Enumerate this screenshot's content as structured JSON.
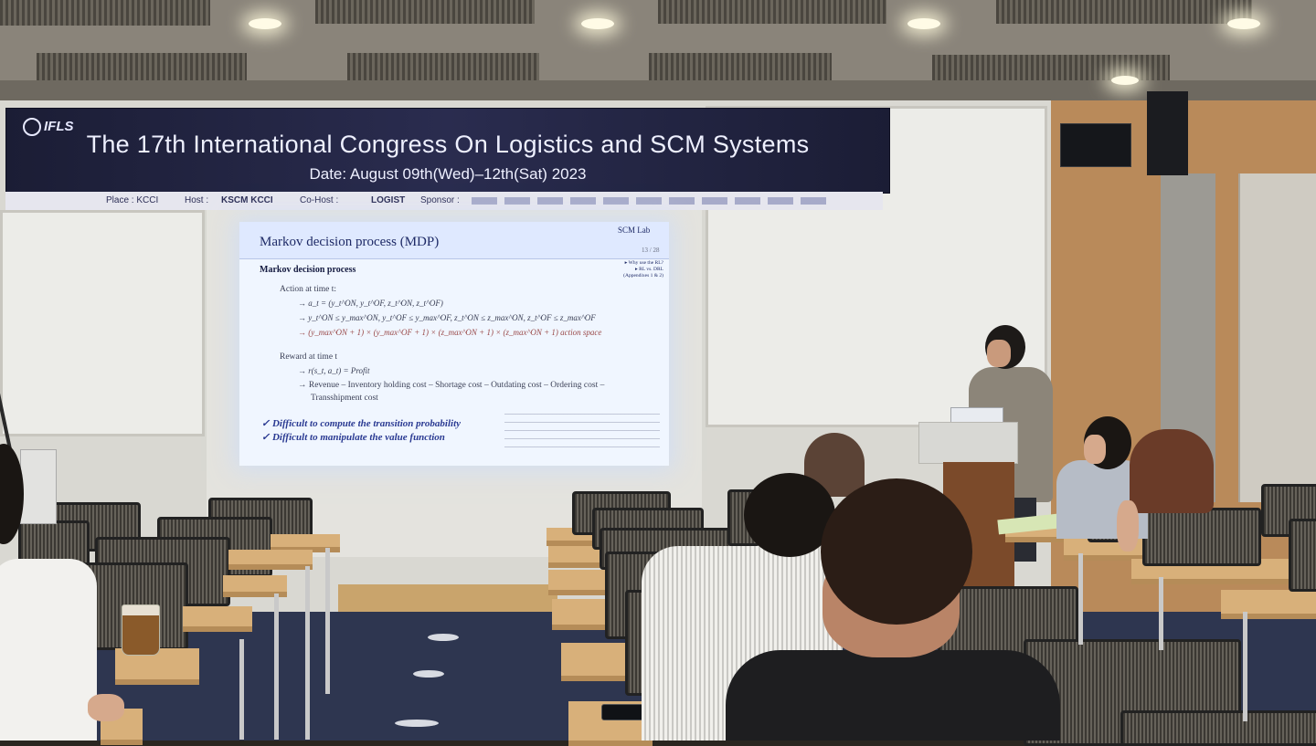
{
  "banner": {
    "logo": "IFLS",
    "title": "The 17th International Congress On Logistics and SCM Systems",
    "date": "Date: August 09th(Wed)–12th(Sat) 2023",
    "place": "Place : KCCI",
    "host": "Host :",
    "host_names": "KSCM   KCCI",
    "cohost": "Co-Host :",
    "cohost_name": "LOGIST",
    "sponsor": "Sponsor :"
  },
  "slide": {
    "title": "Markov decision process (MDP)",
    "lab": "SCM Lab",
    "page": "13 / 28",
    "subtitle": "Markov decision process",
    "side_box": [
      "▸ Why use the RL?",
      "▸ RL vs. DRL",
      "(Appendixes 1 & 2)"
    ],
    "action_header": "Action at time t:",
    "action_line1": "→ a_t = (y_t^ON, y_t^OF, z_t^ON, z_t^OF)",
    "action_line2": "→ y_t^ON ≤ y_max^ON, y_t^OF ≤ y_max^OF, z_t^ON ≤ z_max^ON, z_t^OF ≤ z_max^OF",
    "action_line3": "→ (y_max^ON + 1) × (y_max^OF + 1) × (z_max^ON + 1) × (z_max^ON + 1) action space",
    "reward_header": "Reward at time t",
    "reward_line1": "→ r(s_t, a_t) = Profit",
    "reward_line2": "→ Revenue – Inventory holding cost – Shortage cost – Outdating cost – Ordering cost –",
    "reward_line3": "Transshipment cost",
    "check1": "✓  Difficult to compute the transition probability",
    "check2": "✓  Difficult to manipulate the value function"
  },
  "colors": {
    "banner_bg": "#1b1d35",
    "slide_title": "#1e2a66",
    "slide_emphasis": "#2a3a92",
    "floor": "#2e3650",
    "wood": "#b98a5a"
  }
}
